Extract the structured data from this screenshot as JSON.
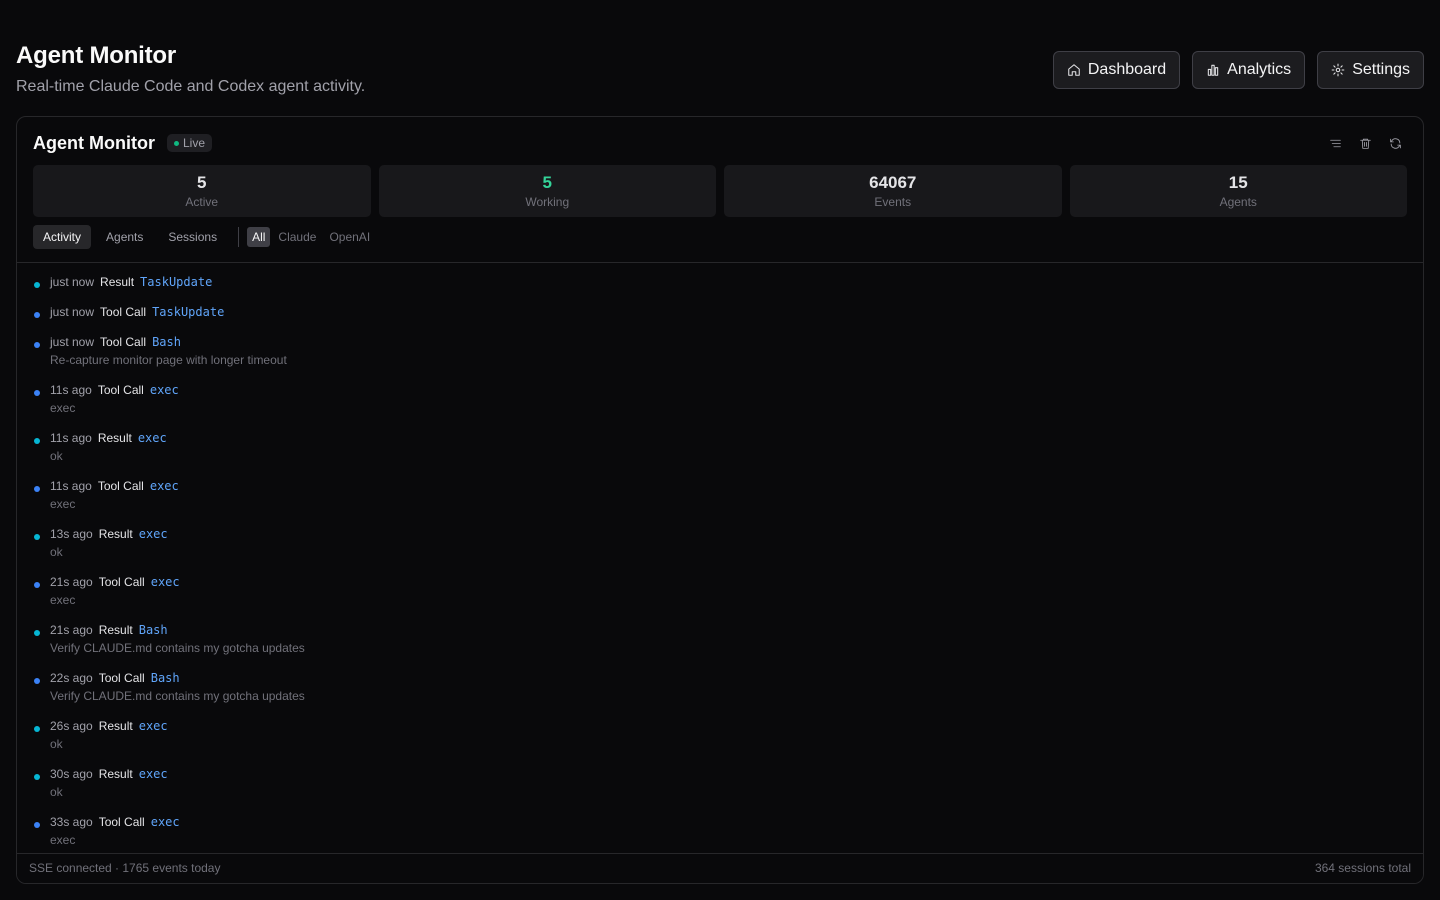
{
  "page": {
    "title": "Agent Monitor",
    "subtitle": "Real-time Claude Code and Codex agent activity."
  },
  "nav": {
    "dashboard": {
      "label": "Dashboard",
      "icon": "home-icon"
    },
    "analytics": {
      "label": "Analytics",
      "icon": "bar-chart-icon"
    },
    "settings": {
      "label": "Settings",
      "icon": "gear-icon"
    }
  },
  "panel": {
    "title": "Agent Monitor",
    "live_label": "Live",
    "actions": [
      "list-icon",
      "trash-icon",
      "refresh-icon"
    ]
  },
  "stats": [
    {
      "value": "5",
      "label": "Active"
    },
    {
      "value": "5",
      "label": "Working"
    },
    {
      "value": "64067",
      "label": "Events"
    },
    {
      "value": "15",
      "label": "Agents"
    }
  ],
  "tabs": [
    {
      "label": "Activity",
      "active": true
    },
    {
      "label": "Agents",
      "active": false
    },
    {
      "label": "Sessions",
      "active": false
    }
  ],
  "filters": [
    {
      "label": "All",
      "active": true
    },
    {
      "label": "Claude",
      "active": false
    },
    {
      "label": "OpenAI",
      "active": false
    }
  ],
  "events": [
    {
      "time": "just now",
      "type": "Result",
      "tool": "TaskUpdate",
      "detail": ""
    },
    {
      "time": "just now",
      "type": "Tool Call",
      "tool": "TaskUpdate",
      "detail": ""
    },
    {
      "time": "just now",
      "type": "Tool Call",
      "tool": "Bash",
      "detail": "Re-capture monitor page with longer timeout"
    },
    {
      "time": "11s ago",
      "type": "Tool Call",
      "tool": "exec",
      "detail": "exec"
    },
    {
      "time": "11s ago",
      "type": "Result",
      "tool": "exec",
      "detail": "ok"
    },
    {
      "time": "11s ago",
      "type": "Tool Call",
      "tool": "exec",
      "detail": "exec"
    },
    {
      "time": "13s ago",
      "type": "Result",
      "tool": "exec",
      "detail": "ok"
    },
    {
      "time": "21s ago",
      "type": "Tool Call",
      "tool": "exec",
      "detail": "exec"
    },
    {
      "time": "21s ago",
      "type": "Result",
      "tool": "Bash",
      "detail": "Verify CLAUDE.md contains my gotcha updates"
    },
    {
      "time": "22s ago",
      "type": "Tool Call",
      "tool": "Bash",
      "detail": "Verify CLAUDE.md contains my gotcha updates"
    },
    {
      "time": "26s ago",
      "type": "Result",
      "tool": "exec",
      "detail": "ok"
    },
    {
      "time": "30s ago",
      "type": "Result",
      "tool": "exec",
      "detail": "ok"
    },
    {
      "time": "33s ago",
      "type": "Tool Call",
      "tool": "exec",
      "detail": "exec"
    }
  ],
  "footer": {
    "left": "SSE connected · 1765 events today",
    "right": "364 sessions total"
  },
  "colors": {
    "background": "#09090b",
    "working_green": "#34d399",
    "result_dot": "#06b6d4",
    "call_dot": "#3b82f6",
    "tool_blue": "#60a5fa",
    "live_dot": "#10b981"
  }
}
